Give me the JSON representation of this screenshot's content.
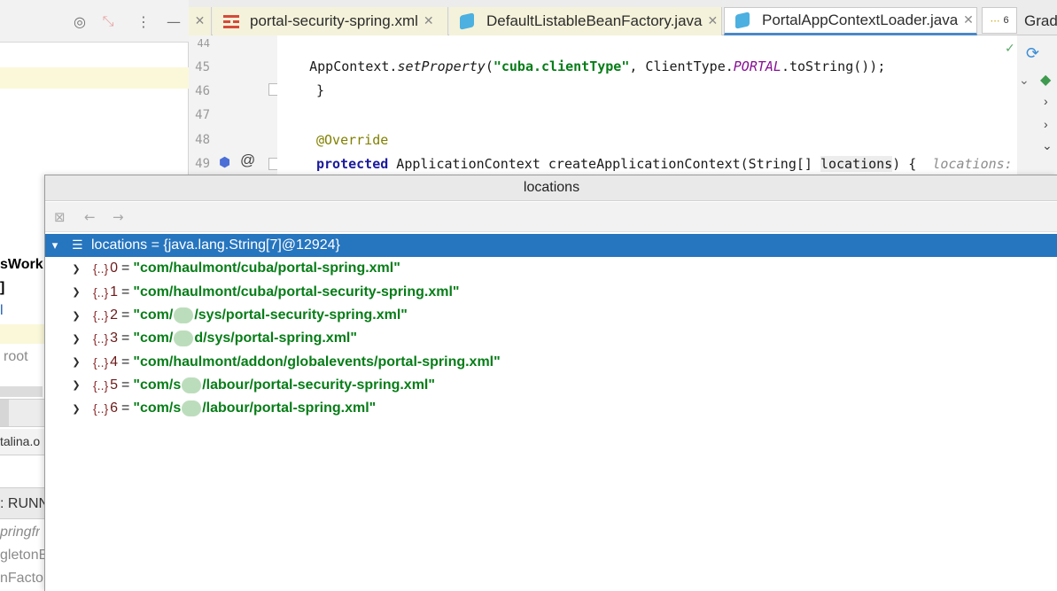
{
  "left": {
    "stubs": [
      "sWork",
      "]",
      "l",
      "root"
    ],
    "bottom_stubs": [
      "talina.o",
      ": RUNN",
      "pringfr",
      "gletonB",
      "nFactor"
    ]
  },
  "tabs": [
    {
      "label": "portal-security-spring.xml",
      "icon": "xml-file-icon",
      "active": false
    },
    {
      "label": "DefaultListableBeanFactory.java",
      "icon": "java-class-icon",
      "active": false
    },
    {
      "label": "PortalAppContextLoader.java",
      "icon": "java-class-icon",
      "active": true
    }
  ],
  "overflow_count": "6",
  "gradle_label": "Grad",
  "editor": {
    "line_numbers": [
      "44",
      "45",
      "46",
      "47",
      "48",
      "49"
    ],
    "line45": {
      "pre": "    AppContext.",
      "method": "setProperty",
      "open": "(",
      "str": "\"cuba.clientType\"",
      "mid": ", ClientType.",
      "const": "PORTAL",
      "post": ".toString());"
    },
    "line46": "}",
    "line48": "@Override",
    "line49": {
      "kw": "protected",
      "rest": " ApplicationContext createApplicationContext(String[] ",
      "param": "locations",
      "end": ") {  ",
      "hint": "locations:"
    }
  },
  "popup": {
    "title": "locations",
    "root": {
      "label": "locations = {java.lang.String[7]@12924}"
    },
    "items": [
      {
        "index": "0",
        "parts": [
          "\"com/haulmont/cuba/portal-spring.xml\""
        ]
      },
      {
        "index": "1",
        "parts": [
          "\"com/haulmont/cuba/portal-security-spring.xml\""
        ]
      },
      {
        "index": "2",
        "parts": [
          "\"com/",
          "/sys/portal-security-spring.xml\""
        ]
      },
      {
        "index": "3",
        "parts": [
          "\"com/",
          "d/sys/portal-spring.xml\""
        ]
      },
      {
        "index": "4",
        "parts": [
          "\"com/haulmont/addon/globalevents/portal-spring.xml\""
        ]
      },
      {
        "index": "5",
        "parts": [
          "\"com/s",
          "/labour/portal-security-spring.xml\""
        ]
      },
      {
        "index": "6",
        "parts": [
          "\"com/s",
          "/labour/portal-spring.xml\""
        ]
      }
    ],
    "obj_icon": "{..}",
    "equals": "="
  }
}
